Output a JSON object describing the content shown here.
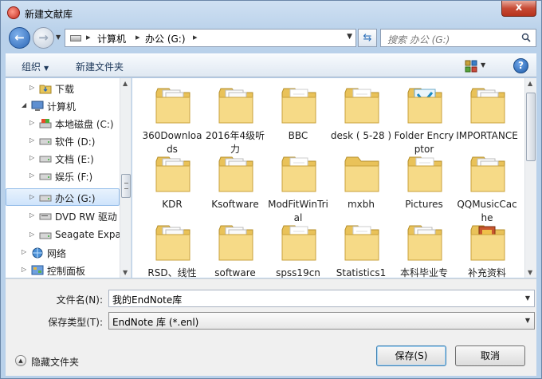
{
  "window": {
    "title": "新建文献库",
    "close_label": "x"
  },
  "address": {
    "crumbs": [
      "计算机",
      "办公 (G:)"
    ],
    "search_placeholder": "搜索 办公 (G:)"
  },
  "toolbar": {
    "organize": "组织",
    "new_folder": "新建文件夹"
  },
  "nav": {
    "items": [
      {
        "label": "下载",
        "icon": "download-folder-icon"
      },
      {
        "label": "计算机",
        "icon": "computer-icon"
      },
      {
        "label": "本地磁盘 (C:)",
        "icon": "system-drive-icon"
      },
      {
        "label": "软件 (D:)",
        "icon": "drive-icon"
      },
      {
        "label": "文档 (E:)",
        "icon": "drive-icon"
      },
      {
        "label": "娱乐 (F:)",
        "icon": "drive-icon"
      },
      {
        "label": "办公 (G:)",
        "icon": "drive-icon"
      },
      {
        "label": "DVD RW 驱动",
        "icon": "dvd-drive-icon"
      },
      {
        "label": "Seagate Expa",
        "icon": "drive-icon"
      },
      {
        "label": "网络",
        "icon": "network-icon"
      },
      {
        "label": "控制面板",
        "icon": "control-panel-icon"
      }
    ]
  },
  "files": [
    {
      "name": "360Downloads",
      "type": "folder-docs"
    },
    {
      "name": "2016年4级听力",
      "type": "folder-docs"
    },
    {
      "name": "BBC",
      "type": "folder-files"
    },
    {
      "name": "desk ( 5-28 )",
      "type": "folder-files"
    },
    {
      "name": "Folder Encryptor",
      "type": "folder-app"
    },
    {
      "name": "IMPORTANCE",
      "type": "folder-docs"
    },
    {
      "name": "KDR",
      "type": "folder-docs"
    },
    {
      "name": "Ksoftware",
      "type": "folder-docs"
    },
    {
      "name": "ModFitWinTrial",
      "type": "folder-files"
    },
    {
      "name": "mxbh",
      "type": "folder-empty"
    },
    {
      "name": "Pictures",
      "type": "folder-files"
    },
    {
      "name": "QQMusicCache",
      "type": "folder-docs"
    },
    {
      "name": "RSD、线性",
      "type": "folder-docs"
    },
    {
      "name": "software",
      "type": "folder-docs"
    },
    {
      "name": "spss19cn",
      "type": "folder-files"
    },
    {
      "name": "Statistics1",
      "type": "folder-files"
    },
    {
      "name": "本科毕业专",
      "type": "folder-docs"
    },
    {
      "name": "补充资料",
      "type": "folder-color"
    }
  ],
  "form": {
    "filename_label": "文件名(N):",
    "filename_value": "我的EndNote库",
    "filetype_label": "保存类型(T):",
    "filetype_value": "EndNote 库 (*.enl)",
    "hide_folders": "隐藏文件夹",
    "save_button": "保存(S)",
    "cancel_button": "取消"
  }
}
